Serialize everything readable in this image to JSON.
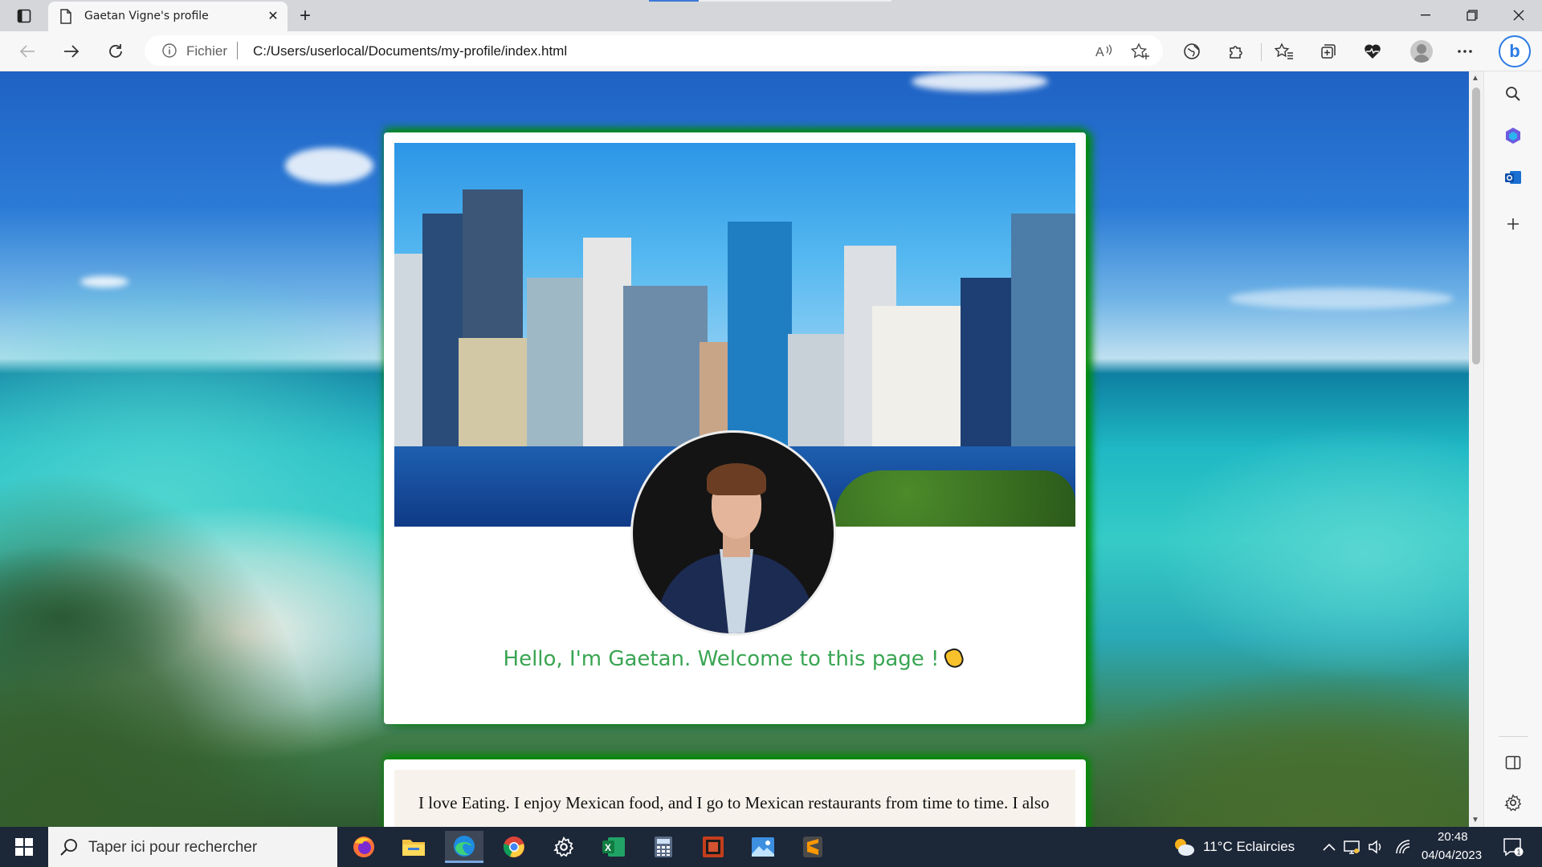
{
  "browser": {
    "tab_title": "Gaetan Vigne's profile",
    "address_scheme": "Fichier",
    "address_url": "C:/Users/userlocal/Documents/my-profile/index.html"
  },
  "page": {
    "greeting": "Hello, I'm Gaetan. Welcome to this page !",
    "bio": "I love Eating. I enjoy Mexican food, and I go to Mexican restaurants from time to time. I also"
  },
  "taskbar": {
    "search_placeholder": "Taper ici pour rechercher",
    "weather": "11°C  Eclaircies",
    "time": "20:48",
    "date": "04/04/2023",
    "notification_count": "1"
  },
  "colors": {
    "greeting": "#39a552",
    "card_glow": "#008c00",
    "accent": "#2c7be5"
  }
}
